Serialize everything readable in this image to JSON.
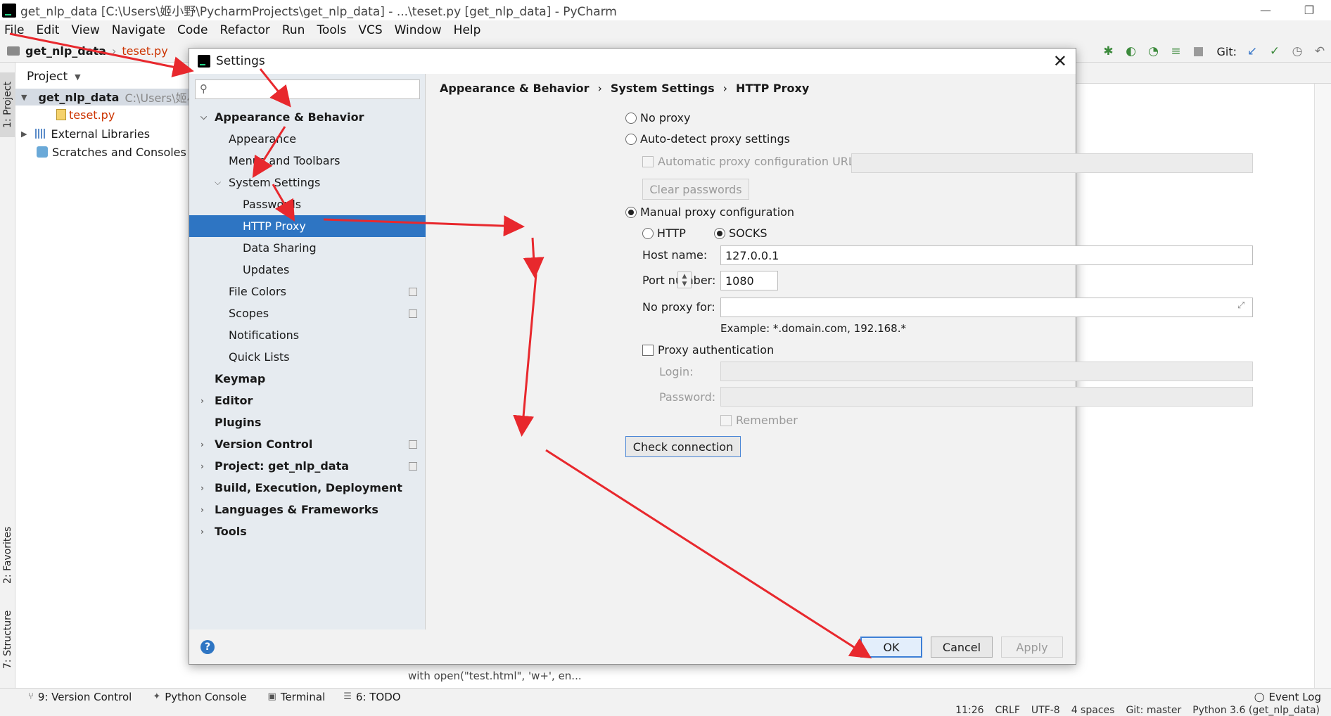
{
  "window": {
    "title": "get_nlp_data [C:\\Users\\姬小野\\PycharmProjects\\get_nlp_data] - ...\\teset.py [get_nlp_data] - PyCharm",
    "minimize": "—",
    "restore": "❐"
  },
  "menu": [
    "File",
    "Edit",
    "View",
    "Navigate",
    "Code",
    "Refactor",
    "Run",
    "Tools",
    "VCS",
    "Window",
    "Help"
  ],
  "navbar": {
    "project": "get_nlp_data",
    "file": "teset.py"
  },
  "toolbar": {
    "git_label": "Git:"
  },
  "left_strip": {
    "project_tab": "1: Project",
    "favorites_tab": "2: Favorites",
    "structure_tab": "7: Structure"
  },
  "project_panel": {
    "header": "Project",
    "root": "get_nlp_data",
    "root_path": "C:\\Users\\姬小",
    "file": "teset.py",
    "external": "External Libraries",
    "scratches": "Scratches and Consoles"
  },
  "editor": {
    "code_hint": "with open(\"test.html\", 'w+', en..."
  },
  "bottom_tabs": {
    "version_control": "9: Version Control",
    "python_console": "Python Console",
    "terminal": "Terminal",
    "todo": "6: TODO",
    "event_log": "Event Log"
  },
  "status": {
    "position": "11:26",
    "line_sep": "CRLF",
    "encoding": "UTF-8",
    "indent": "4 spaces",
    "git": "Git: master",
    "interpreter": "Python 3.6 (get_nlp_data)"
  },
  "dialog": {
    "title": "Settings",
    "close": "✕",
    "search_placeholder": "",
    "nav": {
      "appearance_behavior": "Appearance & Behavior",
      "appearance": "Appearance",
      "menus_toolbars": "Menus and Toolbars",
      "system_settings": "System Settings",
      "passwords": "Passwords",
      "http_proxy": "HTTP Proxy",
      "data_sharing": "Data Sharing",
      "updates": "Updates",
      "file_colors": "File Colors",
      "scopes": "Scopes",
      "notifications": "Notifications",
      "quick_lists": "Quick Lists",
      "keymap": "Keymap",
      "editor": "Editor",
      "plugins": "Plugins",
      "version_control": "Version Control",
      "project": "Project: get_nlp_data",
      "build": "Build, Execution, Deployment",
      "languages": "Languages & Frameworks",
      "tools": "Tools"
    },
    "breadcrumb": [
      "Appearance & Behavior",
      "System Settings",
      "HTTP Proxy"
    ],
    "breadcrumb_sep": "›",
    "proxy": {
      "no_proxy": "No proxy",
      "auto_detect": "Auto-detect proxy settings",
      "auto_config_url": "Automatic proxy configuration URL:",
      "clear_passwords": "Clear passwords",
      "manual": "Manual proxy configuration",
      "http": "HTTP",
      "socks": "SOCKS",
      "selected_mode": "manual",
      "selected_type": "socks",
      "host_label": "Host name:",
      "host_value": "127.0.0.1",
      "port_label": "Port number:",
      "port_value": "1080",
      "no_proxy_for_label": "No proxy for:",
      "no_proxy_for_value": "",
      "example": "Example: *.domain.com, 192.168.*",
      "proxy_auth": "Proxy authentication",
      "proxy_auth_checked": false,
      "login_label": "Login:",
      "password_label": "Password:",
      "remember": "Remember",
      "check_connection": "Check connection"
    },
    "buttons": {
      "ok": "OK",
      "cancel": "Cancel",
      "apply": "Apply",
      "help": "?"
    }
  },
  "colors": {
    "selection": "#2e75c3",
    "arrow": "#e8282d",
    "accent": "#3d7fd6"
  }
}
